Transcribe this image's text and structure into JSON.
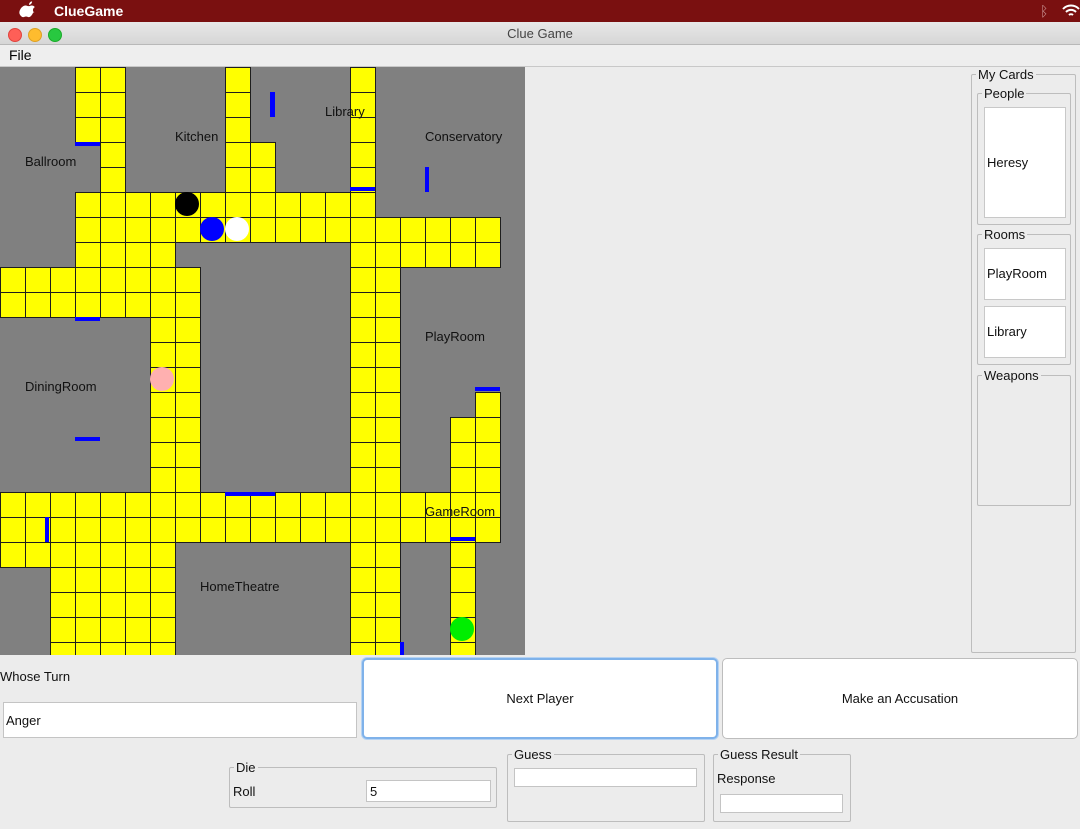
{
  "system": {
    "app_name": "ClueGame"
  },
  "window": {
    "title": "Clue Game",
    "menu": [
      "File"
    ]
  },
  "board": {
    "rooms": [
      "Kitchen",
      "Library",
      "Conservatory",
      "Ballroom",
      "PlayRoom",
      "DiningRoom",
      "GameRoom",
      "HomeTheatre"
    ],
    "colors": {
      "room": "#808080",
      "walkway": "#ffff00",
      "door": "#0000ff"
    },
    "tokens": [
      {
        "color": "#000000"
      },
      {
        "color": "#0000ff"
      },
      {
        "color": "#ffffff"
      },
      {
        "color": "#ffb0b0"
      },
      {
        "color": "#00ee00"
      }
    ]
  },
  "cards": {
    "title": "My Cards",
    "people": {
      "label": "People",
      "items": [
        "Heresy"
      ]
    },
    "rooms": {
      "label": "Rooms",
      "items": [
        "PlayRoom",
        "Library"
      ]
    },
    "weapons": {
      "label": "Weapons",
      "items": []
    }
  },
  "controls": {
    "whose_turn_label": "Whose Turn",
    "whose_turn_value": "Anger",
    "next_player_label": "Next Player",
    "accusation_label": "Make an Accusation",
    "die": {
      "label": "Die",
      "roll_label": "Roll",
      "roll_value": "5"
    },
    "guess": {
      "label": "Guess",
      "value": ""
    },
    "guess_result": {
      "label": "Guess Result",
      "response_label": "Response",
      "value": ""
    }
  }
}
